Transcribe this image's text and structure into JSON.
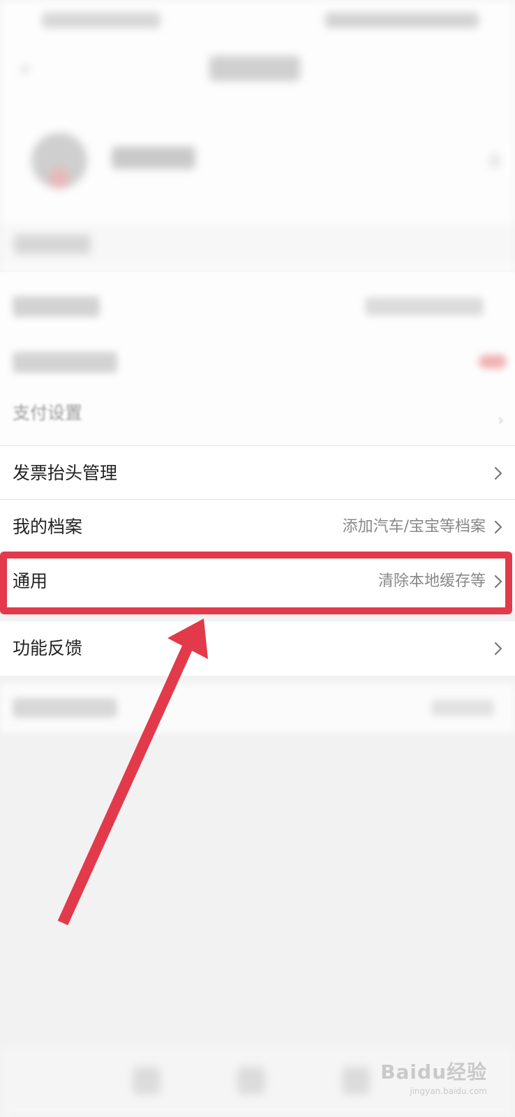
{
  "settings_list": {
    "partial_item": {
      "label": "支付设置"
    },
    "items": [
      {
        "label": "发票抬头管理",
        "value": ""
      },
      {
        "label": "我的档案",
        "value": "添加汽车/宝宝等档案"
      },
      {
        "label": "通用",
        "value": "清除本地缓存等"
      },
      {
        "label": "功能反馈",
        "value": ""
      }
    ]
  },
  "annotation": {
    "highlight_color": "#e23a4a",
    "highlighted_item": "通用"
  },
  "watermark": {
    "main": "Baidu经验",
    "sub": "jingyan.baidu.com"
  },
  "icons": {
    "chevron": "chevron-right-icon",
    "back": "back-arrow-icon"
  }
}
